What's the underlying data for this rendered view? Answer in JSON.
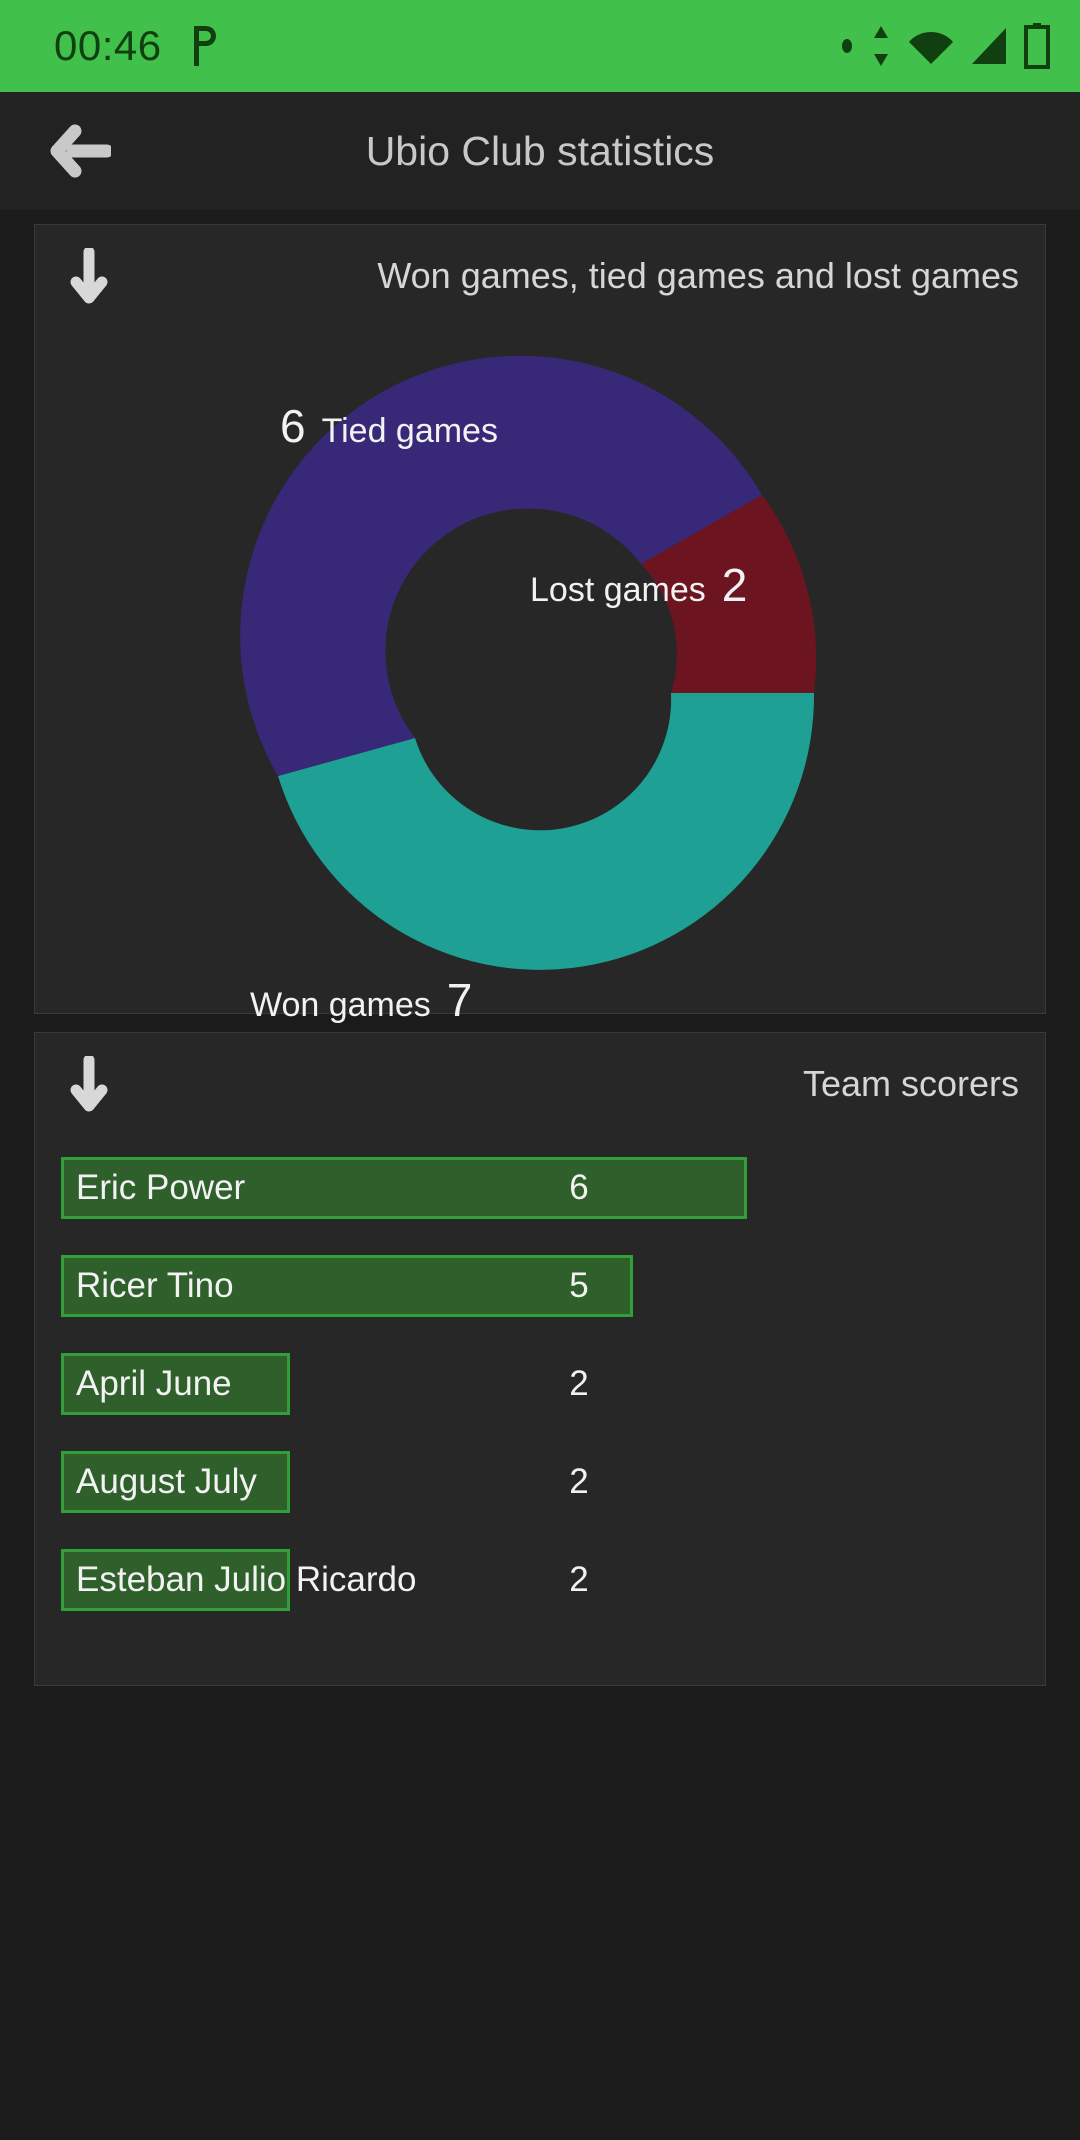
{
  "status_bar": {
    "clock": "00:46",
    "background_color": "#41c14b",
    "icon_color": "#10400f",
    "left_icons": [
      "p-app-icon"
    ],
    "right_icons": [
      "dot-icon",
      "sync-arrows-icon",
      "wifi-icon",
      "signal-icon",
      "battery-charging-icon"
    ]
  },
  "app_bar": {
    "back_icon": "arrow-left-icon",
    "title": "Ubio Club statistics"
  },
  "donut_card": {
    "collapse_icon": "arrow-down-icon",
    "title": "Won games, tied games and lost games"
  },
  "scorers_card": {
    "collapse_icon": "arrow-down-icon",
    "title": "Team scorers",
    "bar_fill_color": "#2f5f2b",
    "bar_border_color": "#31a038",
    "rows": [
      {
        "name": "Eric Power",
        "value": "6"
      },
      {
        "name": "Ricer Tino",
        "value": "5"
      },
      {
        "name": "April June",
        "value": "2"
      },
      {
        "name": "August July",
        "value": "2"
      },
      {
        "name": "Esteban Julio Ricardo",
        "value": "2"
      }
    ]
  },
  "chart_data": [
    {
      "type": "pie",
      "title": "Won games, tied games and lost games",
      "subtype": "donut",
      "total": 15,
      "start_angle_deg": 90,
      "direction": "clockwise",
      "labels": [
        "Won games",
        "Lost games",
        "Tied games"
      ],
      "values": [
        7,
        2,
        6
      ],
      "colors": [
        "#1fa095",
        "#6c1420",
        "#382878"
      ],
      "slices": [
        {
          "label": "Won games",
          "value": 7,
          "color": "#1fa095",
          "percent": 46.7
        },
        {
          "label": "Lost games",
          "value": 2,
          "color": "#6c1420",
          "percent": 13.3
        },
        {
          "label": "Tied games",
          "value": 6,
          "color": "#382878",
          "percent": 40.0
        }
      ],
      "legend": "inline-labels",
      "grid": false
    },
    {
      "type": "bar",
      "orientation": "horizontal",
      "title": "Team scorers",
      "categories": [
        "Eric Power",
        "Ricer Tino",
        "April June",
        "August July",
        "Esteban Julio Ricardo"
      ],
      "values": [
        6,
        5,
        2,
        2,
        2
      ],
      "xlabel": "",
      "ylabel": "",
      "xlim": [
        0,
        6
      ],
      "grid": false,
      "bar_color": "#2f5f2b",
      "bar_border_color": "#31a038"
    }
  ]
}
